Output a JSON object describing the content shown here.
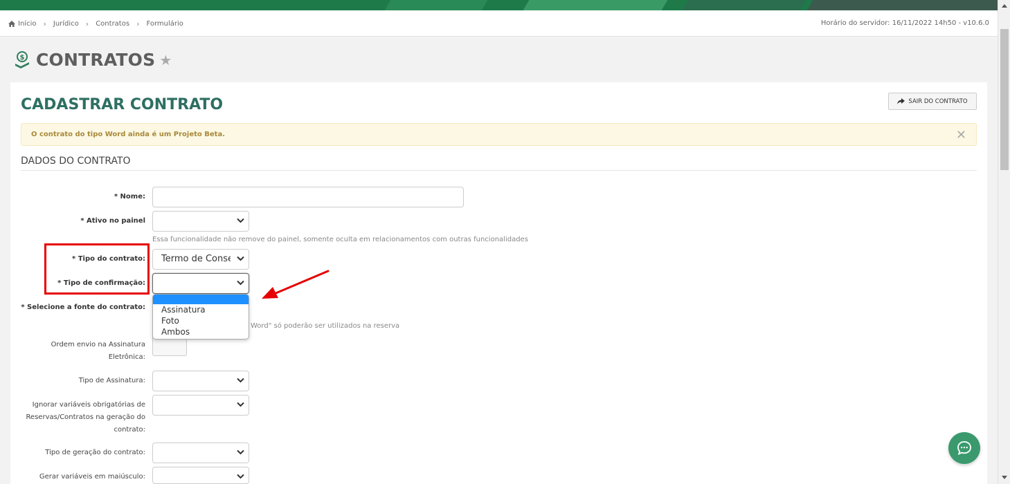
{
  "breadcrumb": {
    "items": [
      "Início",
      "Jurídico",
      "Contratos",
      "Formulário"
    ],
    "server_time": "Horário do servidor: 16/11/2022 14h50 - v10.6.0"
  },
  "page": {
    "title": "CONTRATOS"
  },
  "form": {
    "title": "CADASTRAR CONTRATO",
    "exit_label": "SAIR DO CONTRATO",
    "alert": "O contrato do tipo Word ainda é um Projeto Beta.",
    "section_title": "DADOS DO CONTRATO",
    "fields": {
      "nome": "* Nome:",
      "ativo": "* Ativo no painel",
      "ativo_help": "Essa funcionalidade não remove do painel, somente oculta em relacionamentos com outras funcionalidades",
      "tipo_contrato": "* Tipo do contrato:",
      "tipo_contrato_value": "Termo de Consentimento",
      "tipo_confirmacao": "* Tipo de confirmação:",
      "fonte": "* Selecione a fonte do contrato:",
      "fonte_help": "Word\" só poderão ser utilizados na reserva",
      "ordem_line1": "Ordem envio na Assinatura",
      "ordem_line2": "Eletrônica:",
      "tipo_assinatura": "Tipo de Assinatura:",
      "ignorar_line1": "Ignorar variáveis obrigatórias de",
      "ignorar_line2": "Reservas/Contratos na geração do",
      "ignorar_line3": "contrato:",
      "tipo_geracao": "Tipo de geração do contrato:",
      "maiusculo": "Gerar variáveis em maiúsculo:"
    },
    "dropdown_options": [
      "Assinatura",
      "Foto",
      "Ambos"
    ]
  },
  "colors": {
    "brand_green": "#1f7a4a",
    "title_teal": "#2e6f62",
    "highlight_red": "#e60000",
    "dropdown_selected": "#1e90ff",
    "chat_green": "#3a9a6d"
  }
}
